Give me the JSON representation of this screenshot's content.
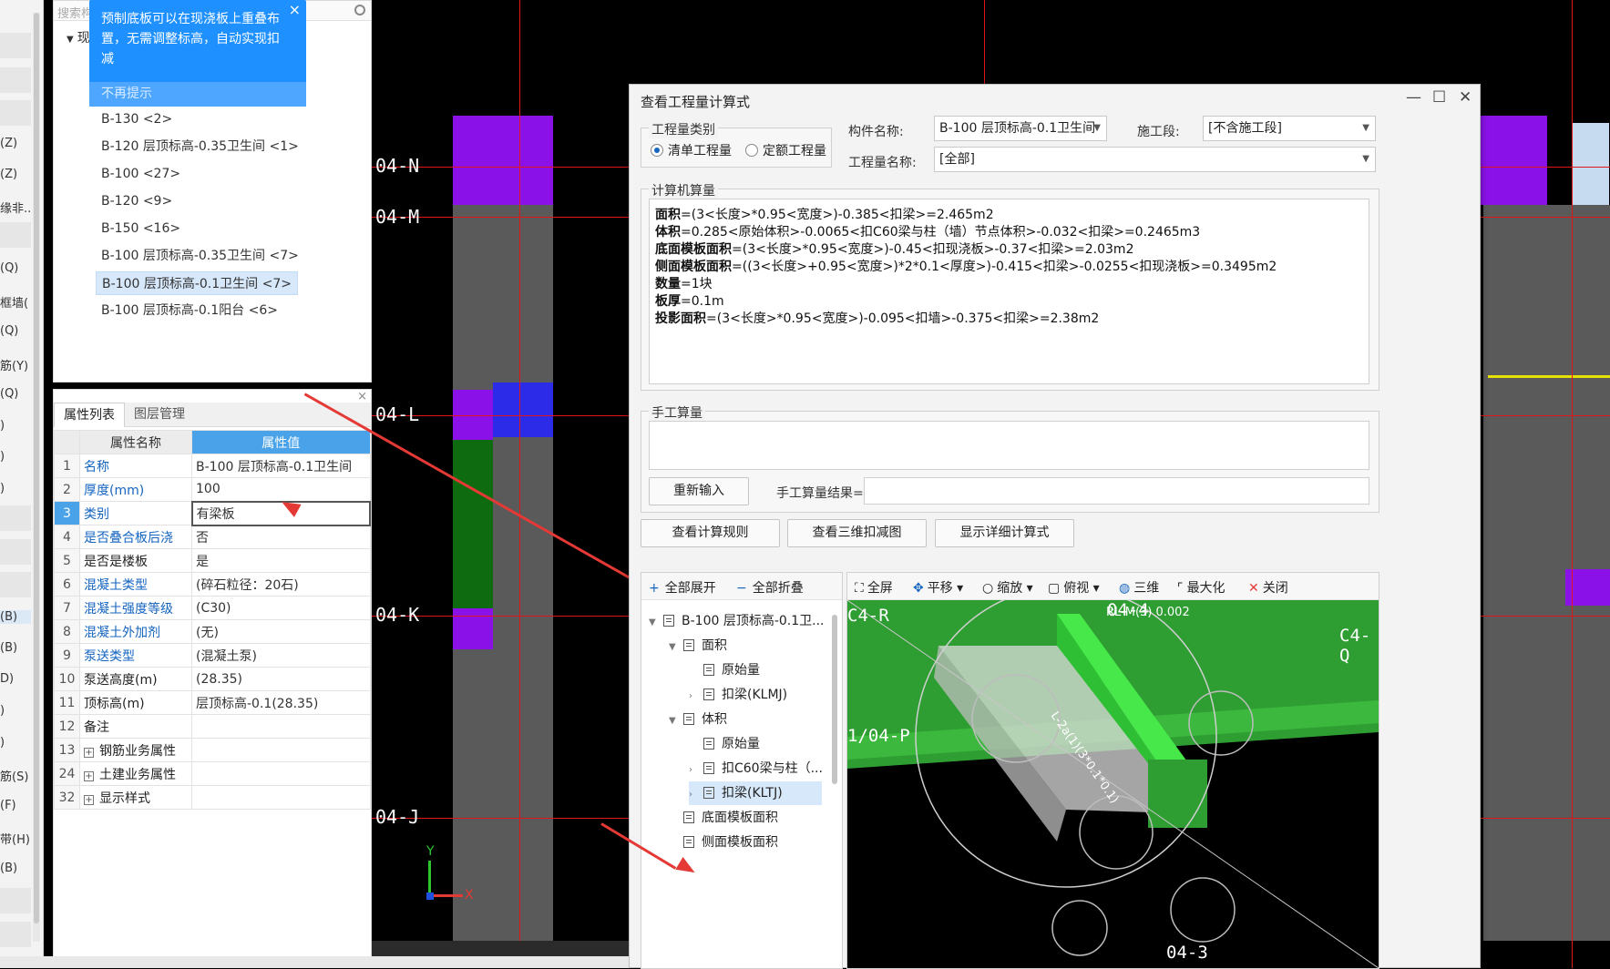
{
  "left_strip": {
    "labels": [
      "(Z)",
      "(Z)",
      "缘非..",
      "(Q)",
      "框墙(",
      "(Q)",
      "筋(Y)",
      "(Q)",
      ")",
      ")",
      ")",
      "(B)",
      "(B)",
      "D)",
      ")",
      ")",
      "筋(S)",
      "(F)",
      "带(H)",
      "(B)"
    ]
  },
  "tree": {
    "search_placeholder": "搜索构",
    "root": "现",
    "items": [
      "B-130 <2>",
      "B-120 层顶标高-0.35卫生间 <1>",
      "B-100 <27>",
      "B-120 <9>",
      "B-150 <16>",
      "B-100 层顶标高-0.35卫生间 <7>",
      "B-100 层顶标高-0.1卫生间 <7>",
      "B-100 层顶标高-0.1阳台 <6>"
    ],
    "selected_index": 6
  },
  "tip": {
    "text": "预制底板可以在现浇板上重叠布置，无需调整标高，自动实现扣减",
    "dismiss": "不再提示",
    "close": "×"
  },
  "properties": {
    "tabs": [
      "属性列表",
      "图层管理"
    ],
    "headers": [
      "属性名称",
      "属性值"
    ],
    "rows": [
      {
        "no": "1",
        "name": "名称",
        "value": "B-100 层顶标高-0.1卫生间"
      },
      {
        "no": "2",
        "name": "厚度(mm)",
        "value": "100"
      },
      {
        "no": "3",
        "name": "类别",
        "value": "有梁板"
      },
      {
        "no": "4",
        "name": "是否叠合板后浇",
        "value": "否"
      },
      {
        "no": "5",
        "name": "是否是楼板",
        "value": "是"
      },
      {
        "no": "6",
        "name": "混凝土类型",
        "value": "(碎石粒径：20石)"
      },
      {
        "no": "7",
        "name": "混凝土强度等级",
        "value": "(C30)"
      },
      {
        "no": "8",
        "name": "混凝土外加剂",
        "value": "(无)"
      },
      {
        "no": "9",
        "name": "泵送类型",
        "value": "(混凝土泵)"
      },
      {
        "no": "10",
        "name": "泵送高度(m)",
        "value": "(28.35)"
      },
      {
        "no": "11",
        "name": "顶标高(m)",
        "value": "层顶标高-0.1(28.35)"
      },
      {
        "no": "12",
        "name": "备注",
        "value": ""
      },
      {
        "no": "13",
        "name": "钢筋业务属性",
        "value": ""
      },
      {
        "no": "24",
        "name": "土建业务属性",
        "value": ""
      },
      {
        "no": "32",
        "name": "显示样式",
        "value": ""
      }
    ]
  },
  "axes": [
    "04-N",
    "04-M",
    "04-L",
    "04-K",
    "04-J"
  ],
  "dialog": {
    "title": "查看工程量计算式",
    "qty_type_label": "工程量类别",
    "radio1": "清单工程量",
    "radio2": "定额工程量",
    "member_label": "构件名称:",
    "member_value": "B-100 层顶标高-0.1卫生间",
    "stage_label": "施工段:",
    "stage_value": "[不含施工段]",
    "qty_name_label": "工程量名称:",
    "qty_name_value": "[全部]",
    "computer_label": "计算机算量",
    "formulas": [
      {
        "k": "面积",
        "f": "=(3<长度>*0.95<宽度>)-0.385<扣梁>=2.465m2"
      },
      {
        "k": "体积",
        "f": "=0.285<原始体积>-0.0065<扣C60梁与柱（墙）节点体积>-0.032<扣梁>=0.2465m3"
      },
      {
        "k": "底面模板面积",
        "f": "=(3<长度>*0.95<宽度>)-0.45<扣现浇板>-0.37<扣梁>=2.03m2"
      },
      {
        "k": "侧面模板面积",
        "f": "=((3<长度>+0.95<宽度>)*2*0.1<厚度>)-0.415<扣梁>-0.0255<扣现浇板>=0.3495m2"
      },
      {
        "k": "数量",
        "f": "=1块"
      },
      {
        "k": "板厚",
        "f": "=0.1m"
      },
      {
        "k": "投影面积",
        "f": "=(3<长度>*0.95<宽度>)-0.095<扣墙>-0.375<扣梁>=2.38m2"
      }
    ],
    "manual_label": "手工算量",
    "reinput": "重新输入",
    "manual_result_label": "手工算量结果=",
    "btn_rules": "查看计算规则",
    "btn_3d": "查看三维扣减图",
    "btn_detail": "显示详细计算式",
    "tree_toolbar": {
      "expand": "全部展开",
      "collapse": "全部折叠"
    },
    "tree_items": [
      {
        "text": "B-100 层顶标高-0.1卫...",
        "level": 0,
        "exp": "▼"
      },
      {
        "text": "面积",
        "level": 1,
        "exp": "▼"
      },
      {
        "text": "原始量",
        "level": 2,
        "exp": ""
      },
      {
        "text": "扣梁(KLMJ)",
        "level": 2,
        "exp": "›"
      },
      {
        "text": "体积",
        "level": 1,
        "exp": "▼"
      },
      {
        "text": "原始量",
        "level": 2,
        "exp": ""
      },
      {
        "text": "扣C60梁与柱（...",
        "level": 2,
        "exp": "›"
      },
      {
        "text": "扣梁(KLTJ)",
        "level": 2,
        "exp": "›"
      },
      {
        "text": "底面模板面积",
        "level": 1,
        "exp": ""
      },
      {
        "text": "侧面模板面积",
        "level": 1,
        "exp": ""
      }
    ],
    "tree_selected": 7,
    "view_toolbar": {
      "full": "全屏",
      "pan": "平移",
      "zoom": "缩放",
      "top": "俯视",
      "three": "三维",
      "max": "最大化",
      "close": "关闭"
    },
    "view_labels": {
      "a": "C4-R",
      "b": "04-4",
      "c": "C4-Q",
      "d": "1/04-P",
      "e": "04-3",
      "f": "RL-M(3) 0.002",
      "g": "L-2a(1)(3*0.1*0.1)"
    }
  },
  "axis_gizmo": {
    "y": "Y",
    "x": "X"
  }
}
